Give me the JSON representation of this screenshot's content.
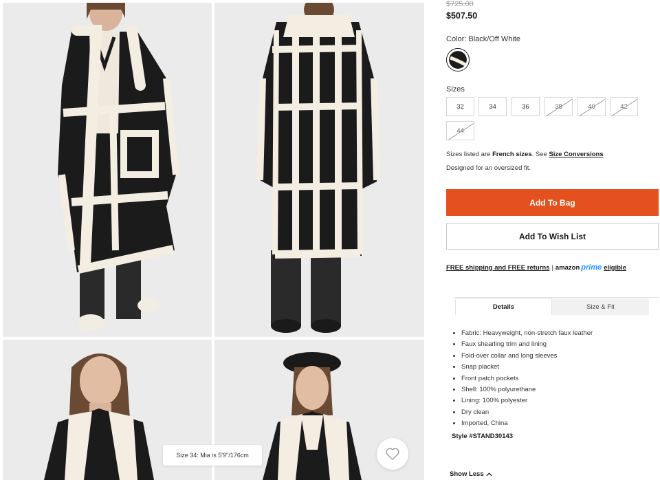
{
  "gallery": {
    "size_tooltip": "Size 34: Mia is 5'9\"/176cm",
    "wishlist_icon": "heart-outline-icon"
  },
  "product": {
    "original_price": "$725.00",
    "sale_price": "$507.50",
    "color_label": "Color:",
    "color_value": "Black/Off White",
    "sizes_label": "Sizes",
    "sizes": [
      {
        "label": "32",
        "available": true
      },
      {
        "label": "34",
        "available": true
      },
      {
        "label": "36",
        "available": true
      },
      {
        "label": "38",
        "available": false
      },
      {
        "label": "40",
        "available": false
      },
      {
        "label": "42",
        "available": false
      },
      {
        "label": "44",
        "available": false
      }
    ],
    "size_note_prefix": "Sizes listed are",
    "size_note_bold": "French sizes",
    "size_note_mid": ".  See",
    "size_conversions_link": "Size Conversions",
    "fit_note": "Designed for an oversized fit.",
    "add_to_bag": "Add To Bag",
    "add_to_wishlist": "Add To Wish List",
    "shipping_link": "FREE shipping and FREE returns",
    "shipping_sep": "|",
    "amazon_word": "amazon",
    "prime_word": "prime",
    "eligible_link": "eligible",
    "tabs": {
      "details": "Details",
      "size_fit": "Size & Fit"
    },
    "details": [
      "Fabric: Heavyweight, non-stretch faux leather",
      "Faux shearling trim and lining",
      "Fold-over collar and long sleeves",
      "Snap placket",
      "Front patch pockets",
      "Shell: 100% polyurethane",
      "Lining: 100% polyester",
      "Dry clean",
      "Imported, China"
    ],
    "style_code": "Style #STAND30143",
    "show_less": "Show Less"
  },
  "colors": {
    "accent": "#e4501e",
    "prime_blue": "#1a98ff",
    "coat_black": "#1b1b1b",
    "shearling": "#f3ede2"
  }
}
